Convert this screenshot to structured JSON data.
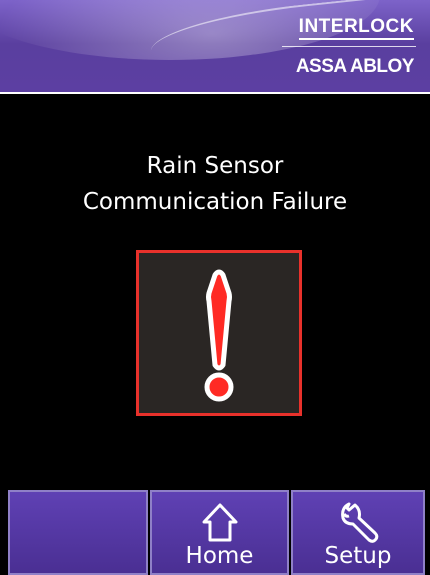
{
  "brand": {
    "top": "INTERLOCK",
    "bottom": "ASSA ABLOY"
  },
  "message": {
    "line1": "Rain Sensor",
    "line2": "Communication Failure"
  },
  "alert": {
    "icon": "exclamation-icon",
    "border_color": "#e8312b",
    "mark_color": "#ff2a24"
  },
  "nav": {
    "home_label": "Home",
    "home_icon": "home-icon",
    "setup_label": "Setup",
    "setup_icon": "wrench-icon"
  },
  "colors": {
    "header_purple": "#5a3f9f",
    "button_purple": "#5f41b4"
  }
}
